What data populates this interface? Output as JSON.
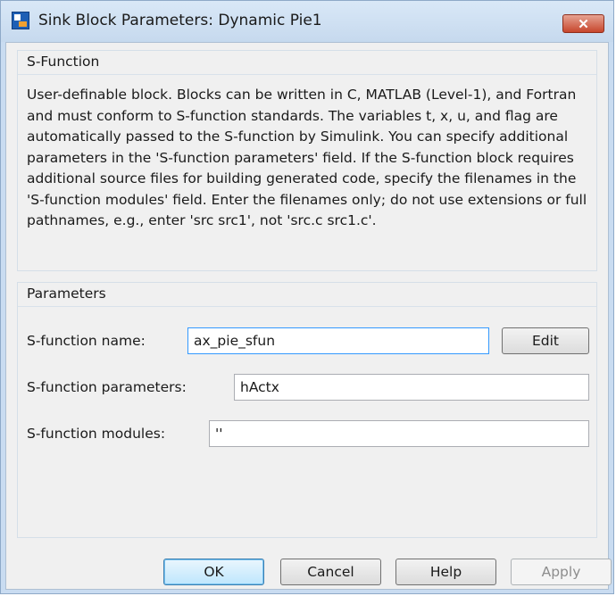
{
  "window": {
    "title": "Sink Block Parameters: Dynamic Pie1",
    "close_label": "✕",
    "accent_color": "#c9dcf1"
  },
  "sfunction_group": {
    "label": "S-Function",
    "description": "User-definable block.  Blocks can be written in C, MATLAB (Level-1), and Fortran and must conform to S-function standards.  The variables t, x, u, and flag are automatically passed to the S-function by Simulink. You can specify additional parameters in the 'S-function parameters' field. If the S-function block requires additional source files for building generated code, specify the filenames in the 'S-function modules' field. Enter the filenames only; do not use extensions or full pathnames, e.g., enter 'src src1', not 'src.c src1.c'."
  },
  "parameters_group": {
    "label": "Parameters",
    "name_label": "S-function name:",
    "name_value": "ax_pie_sfun",
    "edit_label": "Edit",
    "params_label": "S-function parameters:",
    "params_value": "hActx",
    "modules_label": "S-function modules:",
    "modules_value": "''"
  },
  "buttons": {
    "ok": "OK",
    "cancel": "Cancel",
    "help": "Help",
    "apply": "Apply"
  }
}
